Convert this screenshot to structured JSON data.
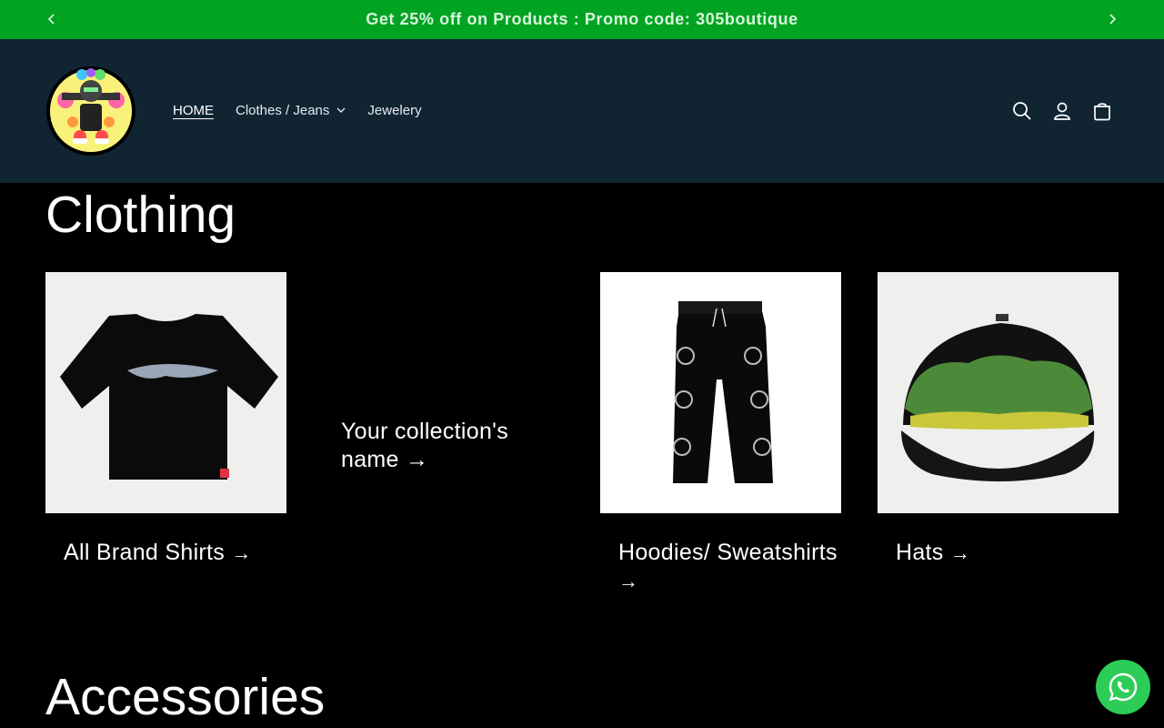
{
  "announcement": {
    "text": "Get 25% off on Products : Promo code: 305boutique"
  },
  "header": {
    "nav": [
      {
        "label": "HOME"
      },
      {
        "label": "Clothes / Jeans"
      },
      {
        "label": "Jewelery"
      }
    ],
    "icons": [
      "search-icon",
      "account-icon",
      "cart-icon"
    ]
  },
  "sections": {
    "clothing_title": "Clothing",
    "accessories_title": "Accessories"
  },
  "collections": [
    {
      "label": "All Brand Shirts",
      "arrow": "→"
    },
    {
      "label": "Your collection's name",
      "arrow": "→"
    },
    {
      "label": "Hoodies/ Sweatshirts",
      "arrow": "→"
    },
    {
      "label": "Hats",
      "arrow": "→"
    }
  ],
  "colors": {
    "announcement_bg": "#00a322",
    "header_bg": "#102432",
    "page_bg": "#000000",
    "whatsapp": "#2dcc56"
  }
}
